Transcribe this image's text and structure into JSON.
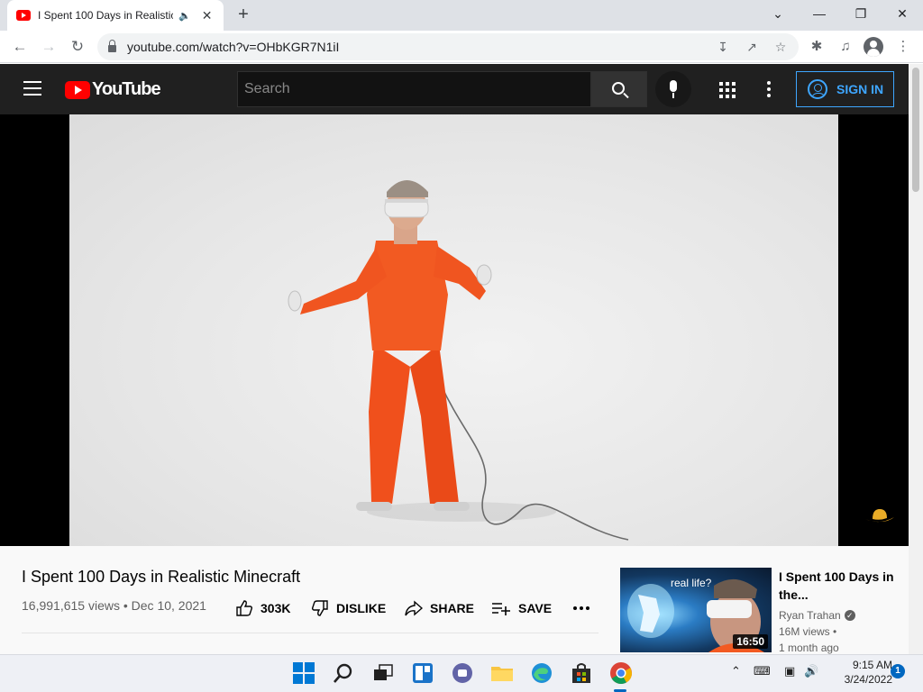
{
  "browser": {
    "tab_title": "I Spent 100 Days in Realistic",
    "tab_audio_icon": "speaker-icon",
    "new_tab_label": "+",
    "url": "youtube.com/watch?v=OHbKGR7N1iI",
    "window_controls": [
      "chevron-down-icon",
      "minimize-icon",
      "restore-icon",
      "close-icon"
    ]
  },
  "youtube": {
    "logo_text": "YouTube",
    "search_placeholder": "Search",
    "sign_in_label": "SIGN IN",
    "accent_color": "#3ea6ff",
    "brand_color": "#ff0000"
  },
  "video": {
    "title": "I Spent 100 Days in Realistic Minecraft",
    "views": "16,991,615 views",
    "date": "Dec 10, 2021",
    "meta_separator": "•",
    "likes_label": "303K",
    "dislike_label": "DISLIKE",
    "share_label": "SHARE",
    "save_label": "SAVE"
  },
  "recommendation": {
    "title": "I Spent 100 Days in the...",
    "thumb_caption": "real life?",
    "duration": "16:50",
    "channel": "Ryan Trahan",
    "views": "16M views •",
    "age": "1 month ago"
  },
  "taskbar": {
    "time": "9:15 AM",
    "date": "3/24/2022",
    "notifications": "1",
    "active_app": "chrome"
  }
}
